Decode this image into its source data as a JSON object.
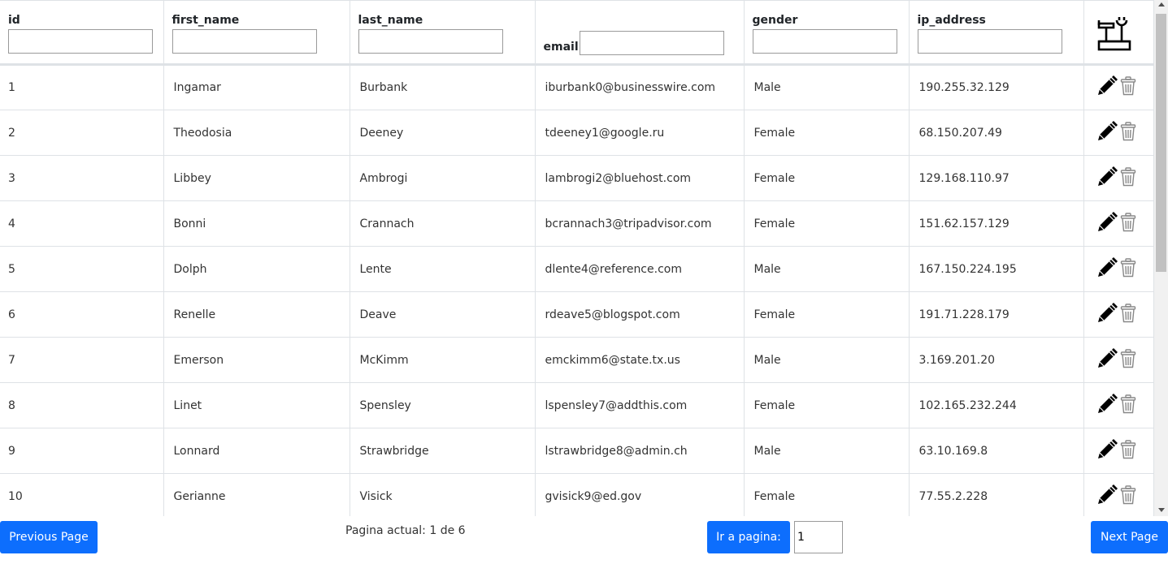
{
  "table": {
    "columns": [
      {
        "key": "id",
        "label": "id",
        "filter_value": ""
      },
      {
        "key": "first_name",
        "label": "first_name",
        "filter_value": ""
      },
      {
        "key": "last_name",
        "label": "last_name",
        "filter_value": ""
      },
      {
        "key": "email",
        "label": "email",
        "filter_value": ""
      },
      {
        "key": "gender",
        "label": "gender",
        "filter_value": ""
      },
      {
        "key": "ip_address",
        "label": "ip_address",
        "filter_value": ""
      }
    ],
    "actions_header_icon": "tools-icon",
    "row_action_icons": [
      "pencil-edit-icon",
      "trash-icon"
    ],
    "rows": [
      [
        "1",
        "Ingamar",
        "Burbank",
        "iburbank0@businesswire.com",
        "Male",
        "190.255.32.129"
      ],
      [
        "2",
        "Theodosia",
        "Deeney",
        "tdeeney1@google.ru",
        "Female",
        "68.150.207.49"
      ],
      [
        "3",
        "Libbey",
        "Ambrogi",
        "lambrogi2@bluehost.com",
        "Female",
        "129.168.110.97"
      ],
      [
        "4",
        "Bonni",
        "Crannach",
        "bcrannach3@tripadvisor.com",
        "Female",
        "151.62.157.129"
      ],
      [
        "5",
        "Dolph",
        "Lente",
        "dlente4@reference.com",
        "Male",
        "167.150.224.195"
      ],
      [
        "6",
        "Renelle",
        "Deave",
        "rdeave5@blogspot.com",
        "Female",
        "191.71.228.179"
      ],
      [
        "7",
        "Emerson",
        "McKimm",
        "emckimm6@state.tx.us",
        "Male",
        "3.169.201.20"
      ],
      [
        "8",
        "Linet",
        "Spensley",
        "lspensley7@addthis.com",
        "Female",
        "102.165.232.244"
      ],
      [
        "9",
        "Lonnard",
        "Strawbridge",
        "lstrawbridge8@admin.ch",
        "Male",
        "63.10.169.8"
      ],
      [
        "10",
        "Gerianne",
        "Visick",
        "gvisick9@ed.gov",
        "Female",
        "77.55.2.228"
      ]
    ]
  },
  "pagination": {
    "previous_label": "Previous Page",
    "next_label": "Next Page",
    "status_text": "Pagina actual: 1 de 6",
    "goto_label": "Ir a pagina:",
    "goto_value": "1"
  },
  "colors": {
    "button_bg": "#0d6efd",
    "button_text": "#ffffff",
    "border": "#dee2e6"
  }
}
